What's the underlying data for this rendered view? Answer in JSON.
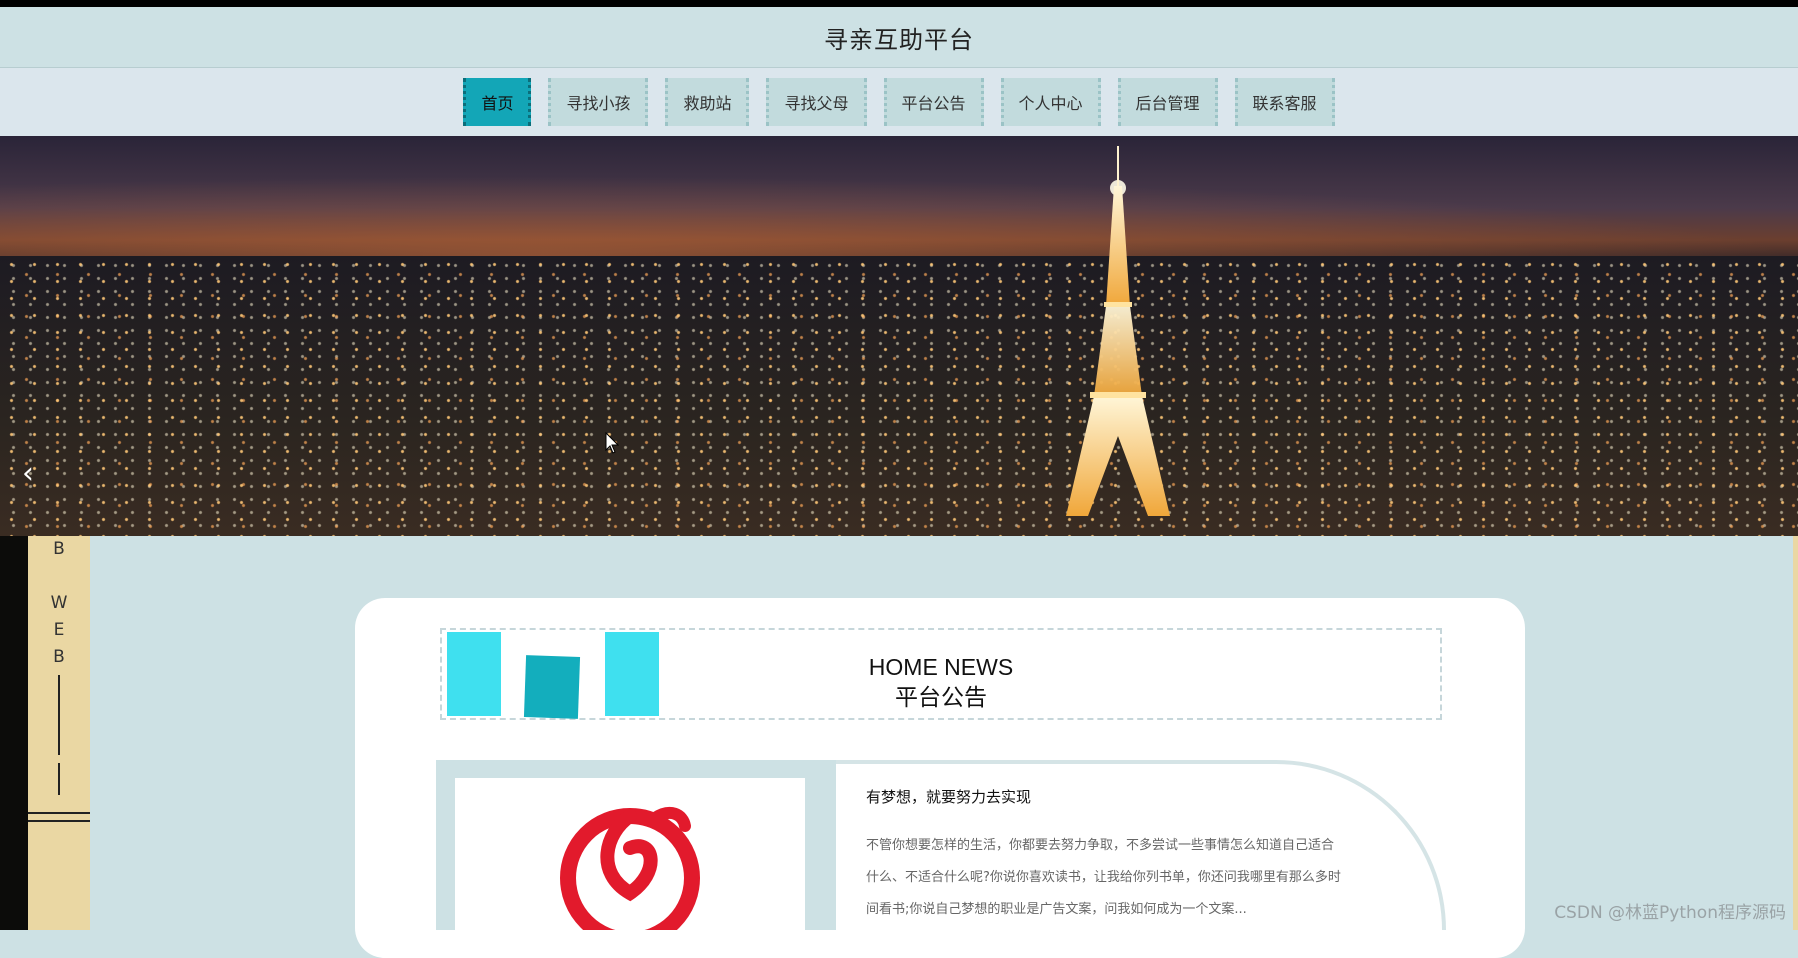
{
  "header": {
    "title": "寻亲互助平台"
  },
  "nav": {
    "items": [
      {
        "label": "首页",
        "active": true
      },
      {
        "label": "寻找小孩"
      },
      {
        "label": "救助站"
      },
      {
        "label": "寻找父母"
      },
      {
        "label": "平台公告"
      },
      {
        "label": "个人中心"
      },
      {
        "label": "后台管理"
      },
      {
        "label": "联系客服"
      }
    ]
  },
  "banner": {
    "prev_icon": "chevron-left-icon"
  },
  "side": {
    "letters": [
      "B",
      "",
      "W",
      "E",
      "B"
    ]
  },
  "news": {
    "heading_en": "HOME NEWS",
    "heading_zh": "平台公告",
    "item": {
      "headline": "有梦想，就要努力去实现",
      "body": "不管你想要怎样的生活，你都要去努力争取，不多尝试一些事情怎么知道自己适合什么、不适合什么呢?你说你喜欢读书，让我给你列书单，你还问我哪里有那么多时间看书;你说自己梦想的职业是广告文案，问我如何成为一个文案..."
    }
  },
  "watermark": "CSDN @林蓝Python程序源码",
  "colors": {
    "accent": "#13a6b7",
    "nav_bg": "#c2dbdd",
    "page_bg": "#cde1e4",
    "side_tan": "#ead7a3"
  }
}
